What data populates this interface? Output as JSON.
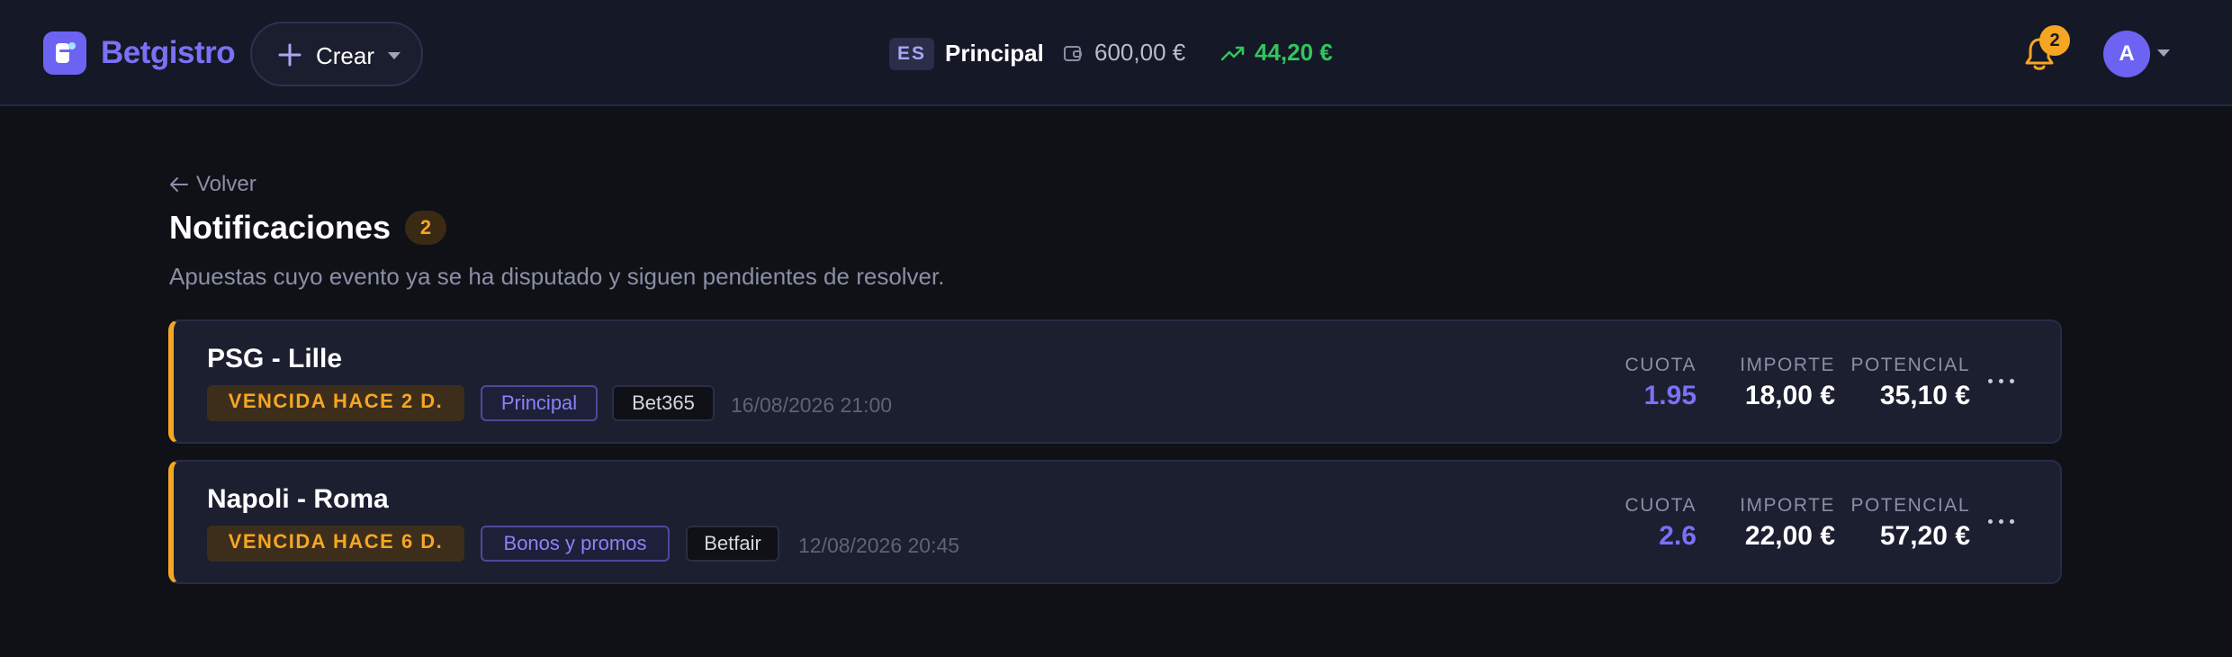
{
  "header": {
    "brand": "Betgistro",
    "create_label": "Crear",
    "account": {
      "code": "ES",
      "name": "Principal",
      "balance": "600,00 €",
      "profit": "44,20 €"
    },
    "notifications_count": "2",
    "avatar_initial": "A"
  },
  "page": {
    "back_label": "Volver",
    "title": "Notificaciones",
    "count": "2",
    "subtitle": "Apuestas cuyo evento ya se ha disputado y siguen pendientes de resolver."
  },
  "labels": {
    "odds": "CUOTA",
    "stake": "IMPORTE",
    "potential": "POTENCIAL"
  },
  "bets": [
    {
      "match": "PSG - Lille",
      "status": "VENCIDA HACE 2 D.",
      "account": "Principal",
      "bookmaker": "Bet365",
      "datetime": "16/08/2026 21:00",
      "odds": "1.95",
      "stake": "18,00 €",
      "potential": "35,10 €"
    },
    {
      "match": "Napoli - Roma",
      "status": "VENCIDA HACE 6 D.",
      "account": "Bonos y promos",
      "bookmaker": "Betfair",
      "datetime": "12/08/2026 20:45",
      "odds": "2.6",
      "stake": "22,00 €",
      "potential": "57,20 €"
    }
  ],
  "colors": {
    "background": "#0f1117",
    "header": "#151826",
    "brand": "#7b71f6",
    "warning": "#f5a623",
    "profit": "#31c55d"
  },
  "icons": [
    "logo-icon",
    "plus-icon",
    "caret-down-icon",
    "wallet-icon",
    "trend-up-icon",
    "bell-icon",
    "arrow-left-icon",
    "more-icon"
  ]
}
